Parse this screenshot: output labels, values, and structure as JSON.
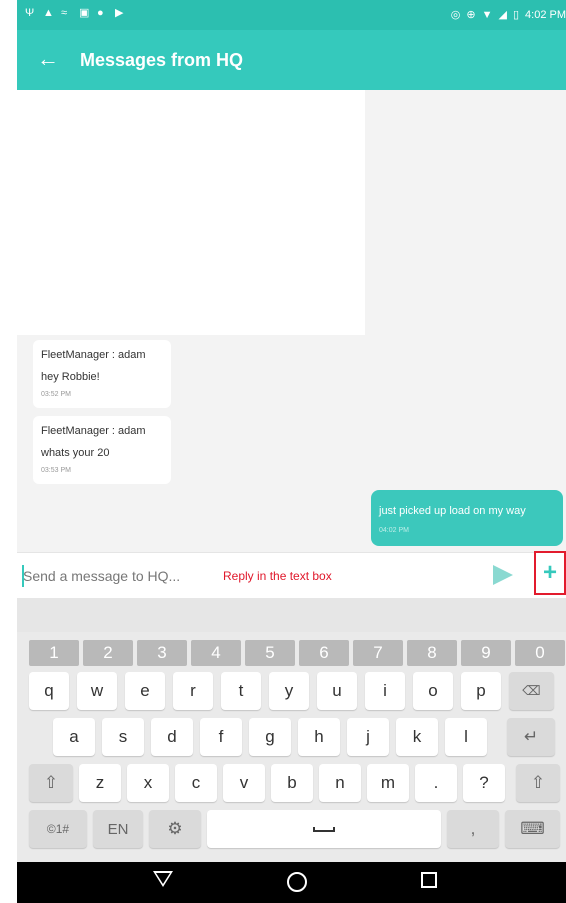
{
  "status_bar": {
    "time": "4:02 PM",
    "left_icons": [
      "usb-icon",
      "alert-icon",
      "cast-icon",
      "image-icon",
      "bug-icon",
      "play-icon"
    ],
    "right_icons": [
      "sync-icon",
      "alarm-icon",
      "wifi-icon",
      "signal-icon",
      "battery-icon"
    ]
  },
  "app_bar": {
    "back_glyph": "←",
    "title": "Messages from HQ"
  },
  "messages": [
    {
      "direction": "incoming",
      "sender": "FleetManager : adam",
      "text": "hey Robbie!",
      "time": "03:52 PM"
    },
    {
      "direction": "incoming",
      "sender": "FleetManager : adam",
      "text": "whats your 20",
      "time": "03:53 PM"
    },
    {
      "direction": "outgoing",
      "text": "just picked up load on my way",
      "time": "04:02 PM"
    }
  ],
  "composer": {
    "placeholder": "Send a message to HQ...",
    "value": "",
    "hint": "Reply in the text box",
    "plus_glyph": "+"
  },
  "keyboard": {
    "numbers": [
      "1",
      "2",
      "3",
      "4",
      "5",
      "6",
      "7",
      "8",
      "9",
      "0"
    ],
    "row1": [
      "q",
      "w",
      "e",
      "r",
      "t",
      "y",
      "u",
      "i",
      "o",
      "p"
    ],
    "row2": [
      "a",
      "s",
      "d",
      "f",
      "g",
      "h",
      "j",
      "k",
      "l"
    ],
    "row3": [
      "z",
      "x",
      "c",
      "v",
      "b",
      "n",
      "m",
      ".",
      "?"
    ],
    "sym_label": "©1#",
    "lang_label": "EN",
    "comma_label": ","
  },
  "colors": {
    "accent": "#35c9bc",
    "statusbar": "#2cbfb0",
    "hint": "#e0182b",
    "highlight_border": "#e21b2d"
  }
}
